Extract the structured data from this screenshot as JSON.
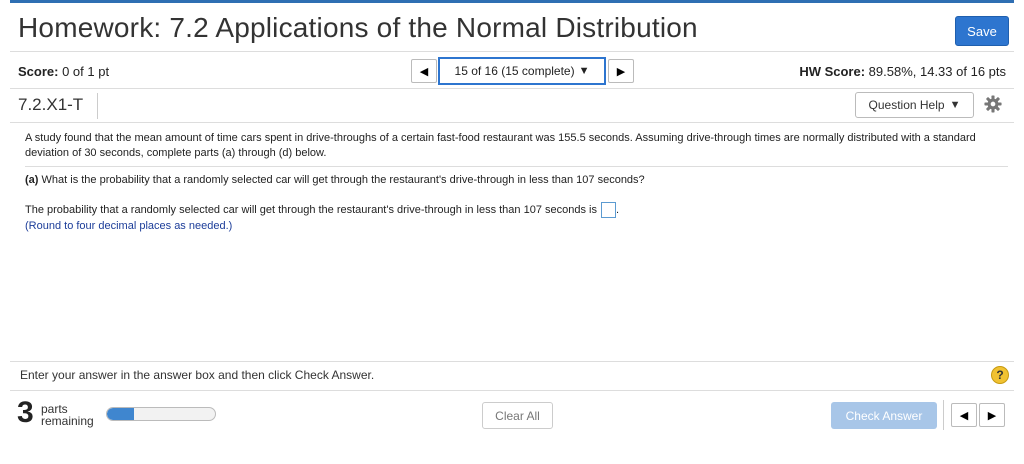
{
  "header": {
    "title": "Homework: 7.2 Applications of the Normal Distribution",
    "save_label": "Save"
  },
  "score_bar": {
    "score_label": "Score:",
    "score_value": "0 of 1 pt",
    "question_selector": "15 of 16 (15 complete)",
    "hw_score_label": "HW Score:",
    "hw_score_value": "89.58%, 14.33 of 16 pts"
  },
  "question": {
    "id": "7.2.X1-T",
    "help_label": "Question Help",
    "statement": "A study found that the mean amount of time cars spent in drive-throughs of a certain fast-food restaurant was 155.5 seconds. Assuming drive-through times are normally distributed with a standard deviation of 30 seconds, complete parts (a) through (d) below.",
    "part_a_label": "(a)",
    "part_a_text": "What is the probability that a randomly selected car will get through the restaurant's drive-through in less than 107 seconds?",
    "answer_prompt": "The probability that a randomly selected car will get through the restaurant's drive-through in less than 107 seconds is",
    "answer_value": "",
    "answer_suffix": ".",
    "round_note": "(Round to four decimal places as needed.)"
  },
  "footer": {
    "instruction": "Enter your answer in the answer box and then click Check Answer.",
    "help_symbol": "?",
    "parts_count": "3",
    "parts_label_1": "parts",
    "parts_label_2": "remaining",
    "progress_fraction": 0.25,
    "clear_label": "Clear All",
    "check_label": "Check Answer"
  },
  "colors": {
    "accent": "#2d75cf",
    "progress": "#3f86cf",
    "check_disabled": "#a8c6e8",
    "note_blue": "#1c3d99",
    "help_yellow": "#f1c232"
  },
  "icons": {
    "prev": "triangle-left-icon",
    "next": "triangle-right-icon",
    "dropdown": "caret-down-icon",
    "settings": "gear-icon",
    "help": "help-circle-icon"
  }
}
